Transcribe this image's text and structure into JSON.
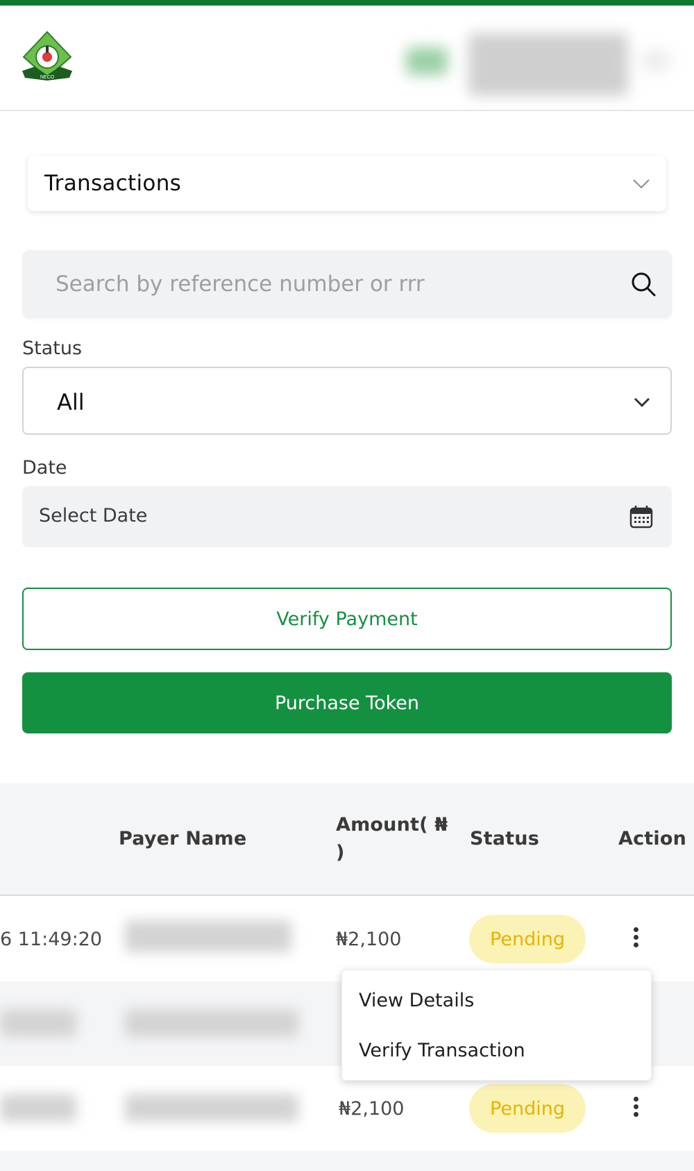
{
  "header": {
    "logo_text": "NECO"
  },
  "section_select": {
    "label": "Transactions"
  },
  "search": {
    "placeholder": "Search by reference number or rrr"
  },
  "filters": {
    "status_label": "Status",
    "status_value": "All",
    "date_label": "Date",
    "date_value": "Select Date"
  },
  "buttons": {
    "verify_payment": "Verify Payment",
    "purchase_token": "Purchase Token"
  },
  "table": {
    "headers": {
      "payer_name": "Payer Name",
      "amount_line1": "Amount( ₦",
      "amount_line2": ")",
      "status": "Status",
      "action": "Action"
    },
    "rows": [
      {
        "date": "6 11:49:20",
        "amount": "₦2,100",
        "status": "Pending"
      },
      {
        "date": "",
        "amount": "",
        "status": ""
      },
      {
        "date": "",
        "amount": "₦2,100",
        "status": "Pending"
      }
    ]
  },
  "action_menu": {
    "items": [
      "View Details",
      "Verify Transaction"
    ]
  },
  "colors": {
    "brand_green": "#149140",
    "pending_bg": "#fbf3b6",
    "pending_text": "#e6b300"
  }
}
